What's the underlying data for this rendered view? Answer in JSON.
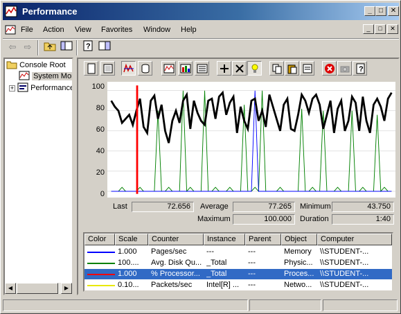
{
  "window": {
    "title": "Performance"
  },
  "titlebar_buttons": {
    "minimize": "_",
    "maximize": "□",
    "close": "✕"
  },
  "menu": [
    "File",
    "Action",
    "View",
    "Favorites",
    "Window",
    "Help"
  ],
  "tree": {
    "root": "Console Root",
    "system_monitor": "System Monitor",
    "perf_logs": "Performance Logs and Alerts"
  },
  "stats": {
    "last_label": "Last",
    "last": "72.656",
    "average_label": "Average",
    "average": "77.265",
    "minimum_label": "Minimum",
    "minimum": "43.750",
    "maximum_label": "Maximum",
    "maximum": "100.000",
    "duration_label": "Duration",
    "duration": "1:40"
  },
  "legend": {
    "headers": [
      "Color",
      "Scale",
      "Counter",
      "Instance",
      "Parent",
      "Object",
      "Computer"
    ],
    "rows": [
      {
        "color": "#0000ff",
        "scale": "1.000",
        "counter": "Pages/sec",
        "instance": "---",
        "parent": "---",
        "object": "Memory",
        "computer": "\\\\STUDENT-...",
        "selected": false
      },
      {
        "color": "#008000",
        "scale": "100....",
        "counter": "Avg. Disk Qu...",
        "instance": "_Total",
        "parent": "---",
        "object": "Physic...",
        "computer": "\\\\STUDENT-...",
        "selected": false
      },
      {
        "color": "#ff0000",
        "scale": "1.000",
        "counter": "% Processor...",
        "instance": "_Total",
        "parent": "---",
        "object": "Proces...",
        "computer": "\\\\STUDENT-...",
        "selected": true
      },
      {
        "color": "#e8e800",
        "scale": "0.10...",
        "counter": "Packets/sec",
        "instance": "Intel[R] ...",
        "parent": "---",
        "object": "Netwo...",
        "computer": "\\\\STUDENT-...",
        "selected": false
      }
    ]
  },
  "chart_data": {
    "type": "line",
    "yticks": [
      "100",
      "80",
      "60",
      "40",
      "20",
      "0"
    ],
    "ylim": [
      0,
      100
    ],
    "grid": true,
    "time_marker_fraction": 0.1,
    "series": [
      {
        "color": "#000000",
        "values": [
          90,
          84,
          80,
          68,
          72,
          76,
          66,
          80,
          92,
          64,
          58,
          90,
          95,
          72,
          86,
          60,
          48,
          70,
          80,
          68,
          90,
          96,
          62,
          90,
          78,
          70,
          66,
          90,
          92,
          72,
          94,
          98,
          76,
          88,
          94,
          58,
          84,
          70,
          62,
          90,
          92,
          70,
          80,
          64,
          96,
          84,
          72,
          60,
          86,
          92,
          62,
          60,
          76,
          96,
          90,
          78,
          92,
          96,
          86,
          62,
          76,
          90,
          58,
          82,
          90,
          60,
          70,
          94,
          88,
          60,
          94,
          70,
          58,
          86,
          92,
          84,
          70,
          92,
          98
        ]
      },
      {
        "color": "#008000",
        "values": [
          0,
          0,
          0,
          0,
          0,
          0,
          0,
          0,
          0,
          80,
          0,
          0,
          0,
          0,
          0,
          0,
          0,
          0,
          0,
          0,
          0,
          0,
          0,
          0,
          0,
          0,
          0,
          0,
          0,
          0,
          0,
          0,
          0,
          0,
          0,
          0,
          0,
          0,
          0,
          0,
          0,
          0,
          0,
          0,
          0,
          0,
          0,
          0,
          0,
          0,
          0,
          0,
          0,
          0,
          0,
          0,
          0,
          0,
          0,
          0,
          0,
          0,
          0,
          0,
          0,
          0,
          0,
          0,
          0,
          0,
          0,
          0,
          0,
          0,
          0,
          0,
          0,
          0,
          0
        ]
      },
      {
        "color": "#0000ff",
        "values": [
          0,
          0,
          0,
          0,
          0,
          0,
          0,
          0,
          0,
          0,
          0,
          0,
          0,
          0,
          0,
          0,
          0,
          0,
          0,
          0,
          0,
          0,
          0,
          0,
          0,
          0,
          0,
          0,
          0,
          0,
          0,
          0,
          0,
          0,
          0,
          0,
          0,
          0,
          0,
          0,
          0,
          0,
          0,
          0,
          0,
          0,
          0,
          0,
          0,
          0,
          0,
          0,
          0,
          0,
          0,
          0,
          0,
          0,
          0,
          0,
          0,
          0,
          0,
          0,
          0,
          0,
          0,
          0,
          0,
          0,
          0,
          0,
          0,
          0,
          0,
          0,
          0,
          0,
          0
        ]
      }
    ]
  }
}
